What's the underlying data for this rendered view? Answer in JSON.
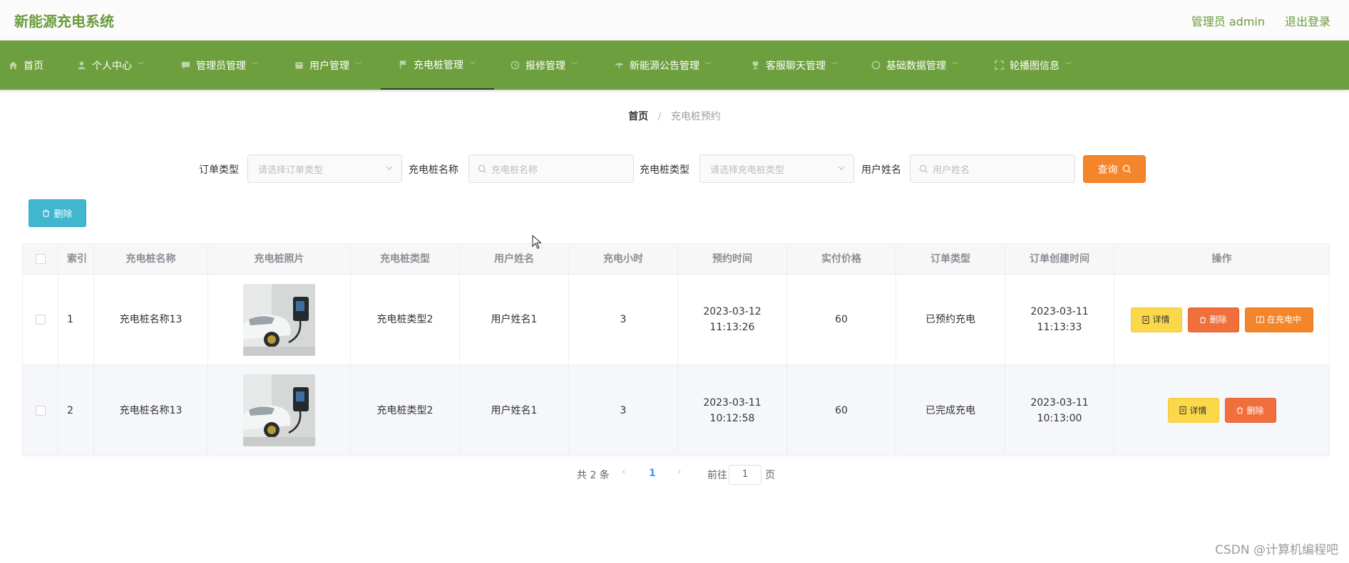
{
  "header": {
    "app_title": "新能源充电系统",
    "user_label": "管理员 admin",
    "logout_label": "退出登录"
  },
  "nav": {
    "items": [
      {
        "label": "首页",
        "icon": "home-icon"
      },
      {
        "label": "个人中心",
        "icon": "user-icon"
      },
      {
        "label": "管理员管理",
        "icon": "chat-icon"
      },
      {
        "label": "用户管理",
        "icon": "calendar-icon"
      },
      {
        "label": "充电桩管理",
        "icon": "flag-icon",
        "active": true
      },
      {
        "label": "报修管理",
        "icon": "clock-icon"
      },
      {
        "label": "新能源公告管理",
        "icon": "umbrella-icon"
      },
      {
        "label": "客服聊天管理",
        "icon": "trophy-icon"
      },
      {
        "label": "基础数据管理",
        "icon": "circle-icon"
      },
      {
        "label": "轮播图信息",
        "icon": "expand-icon"
      }
    ]
  },
  "breadcrumb": {
    "home": "首页",
    "separator": "/",
    "current": "充电桩预约"
  },
  "search": {
    "order_type_label": "订单类型",
    "order_type_placeholder": "请选择订单类型",
    "pile_name_label": "充电桩名称",
    "pile_name_placeholder": "充电桩名称",
    "pile_type_label": "充电桩类型",
    "pile_type_placeholder": "请选择充电桩类型",
    "user_name_label": "用户姓名",
    "user_name_placeholder": "用户姓名",
    "query_label": "查询"
  },
  "toolbar": {
    "delete_label": "删除"
  },
  "table": {
    "columns": [
      "索引",
      "充电桩名称",
      "充电桩照片",
      "充电桩类型",
      "用户姓名",
      "充电小时",
      "预约时间",
      "实付价格",
      "订单类型",
      "订单创建时间",
      "操作"
    ],
    "rows": [
      {
        "index": "1",
        "pile_name": "充电桩名称13",
        "pile_type": "充电桩类型2",
        "user_name": "用户姓名1",
        "hours": "3",
        "reserve_time": "2023-03-12 11:13:26",
        "price": "60",
        "order_type": "已预约充电",
        "created_time": "2023-03-11 11:13:33",
        "actions": [
          "详情",
          "删除",
          "在充电中"
        ]
      },
      {
        "index": "2",
        "pile_name": "充电桩名称13",
        "pile_type": "充电桩类型2",
        "user_name": "用户姓名1",
        "hours": "3",
        "reserve_time": "2023-03-11 10:12:58",
        "price": "60",
        "order_type": "已完成充电",
        "created_time": "2023-03-11 10:13:00",
        "actions": [
          "详情",
          "删除"
        ]
      }
    ]
  },
  "pagination": {
    "total": "共 2 条",
    "prev": "‹",
    "current_page": "1",
    "next": "›",
    "goto_label": "前往",
    "goto_value": "1",
    "page_unit": "页"
  },
  "watermark": "CSDN @计算机编程吧",
  "colors": {
    "brand_green": "#6e9f3e",
    "title_green": "#6a9b3c",
    "query_orange": "#f5852a",
    "delete_teal": "#41b6cf",
    "detail_yellow": "#fbd84a",
    "delete_red": "#f06f3c"
  }
}
